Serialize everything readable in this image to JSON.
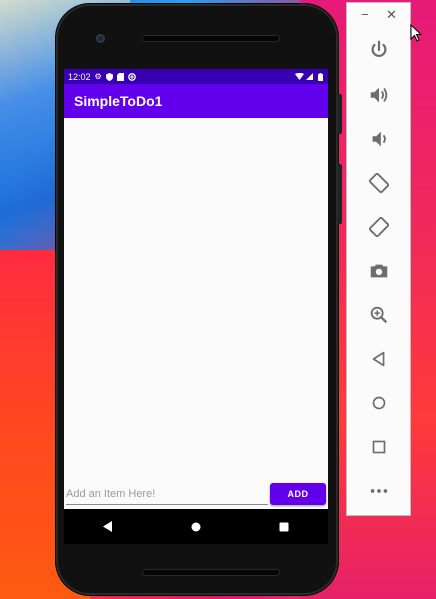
{
  "emulator": {
    "window_controls": {
      "minimize": "−",
      "close": "✕"
    },
    "toolbar_icons": [
      "power-icon",
      "volume-up-icon",
      "volume-down-icon",
      "rotate-left-icon",
      "rotate-right-icon",
      "camera-icon",
      "zoom-icon",
      "back-icon",
      "home-icon",
      "overview-icon",
      "more-icon"
    ]
  },
  "status_bar": {
    "time": "12:02"
  },
  "app_bar": {
    "title": "SimpleToDo1"
  },
  "input": {
    "placeholder": "Add an Item Here!",
    "value": ""
  },
  "add_button": {
    "label": "ADD"
  },
  "colors": {
    "primary": "#6200ee",
    "primary_dark": "#3700b3"
  }
}
